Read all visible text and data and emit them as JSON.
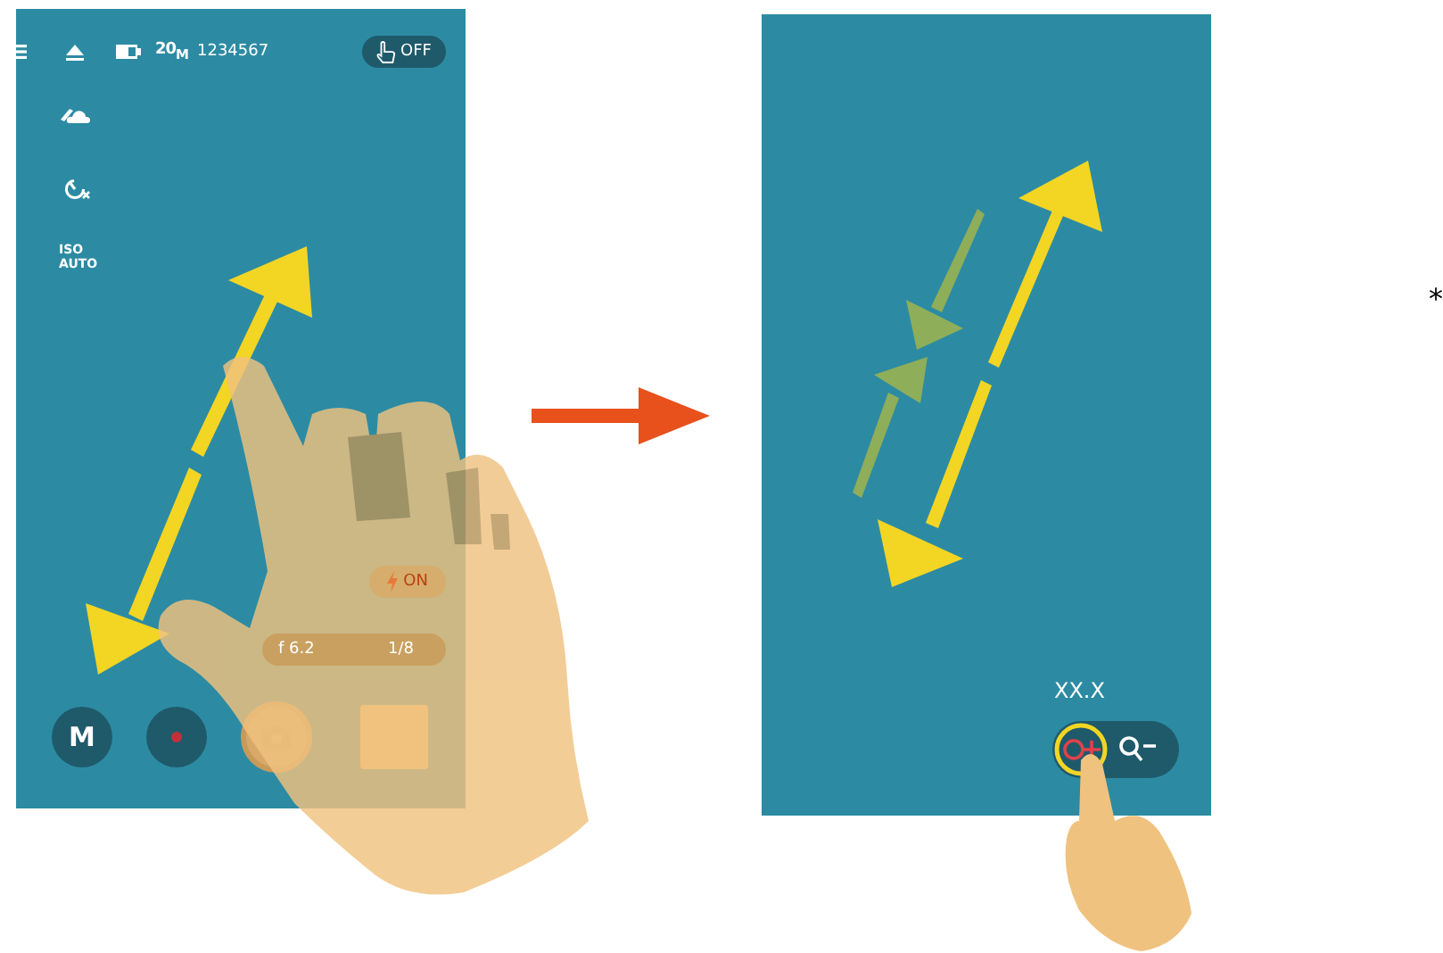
{
  "before_screen": {
    "status_bar": {
      "resolution": "20$_{M}$",
      "shots_remaining": "1234567",
      "touch_shutter": "OFF"
    },
    "side_settings": [
      {
        "kind": "cloud"
      },
      {
        "kind": "timer"
      },
      {
        "kind": "text",
        "label": "ISO\nAUTO"
      }
    ],
    "flash": "ON",
    "aperture": "f 6.2",
    "shutter_speed": "1/8",
    "mode_button": "M"
  },
  "after_screen": {
    "zoom_value": "XX.X"
  },
  "footnote_mark": "*"
}
